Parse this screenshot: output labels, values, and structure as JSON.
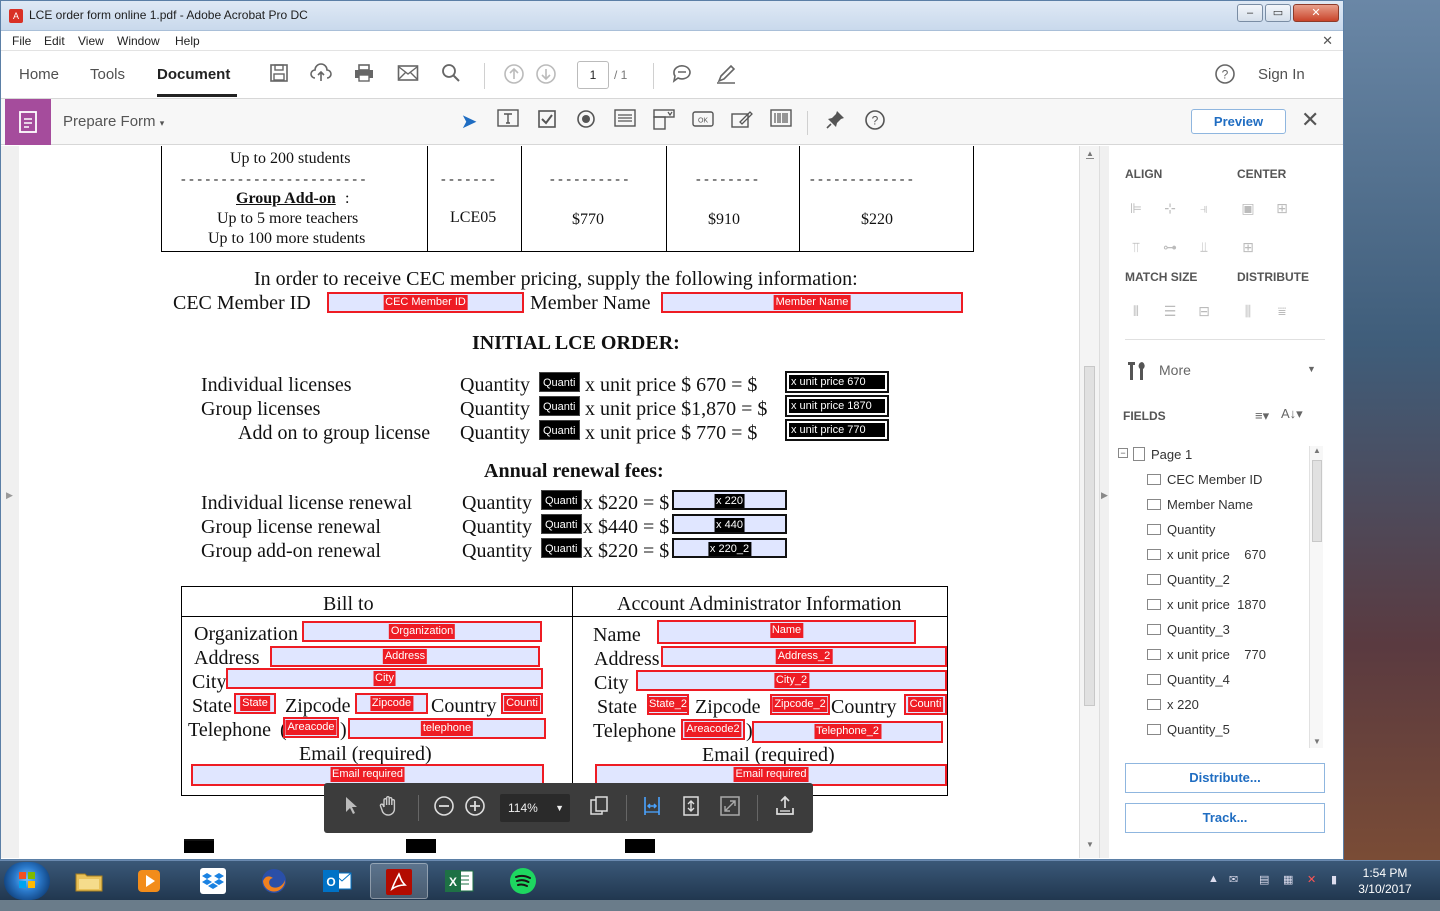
{
  "window": {
    "title": "LCE order form online 1.pdf - Adobe Acrobat Pro DC",
    "icon": "acrobat-icon"
  },
  "menu": [
    "File",
    "Edit",
    "View",
    "Window",
    "Help"
  ],
  "nav": {
    "home": "Home",
    "tools": "Tools",
    "document": "Document",
    "sign_in": "Sign In"
  },
  "page_nav": {
    "current": "1",
    "total": "/ 1"
  },
  "prepare": {
    "title": "Prepare Form",
    "preview": "Preview"
  },
  "doc": {
    "table_top": {
      "row1": "Up to 200 students",
      "dashes_long": "- - - - - - - - - - - - - - - - - - - - - - -",
      "dashes_a": "- - - - - - -",
      "dashes_b": "- - - - - - - - - -",
      "dashes_c": "- - - - - - - -",
      "dashes_d": "- -  - - - - - - - - - - -",
      "addon_title": "Group Add-on",
      "addon_colon": ":",
      "addon_l2": "Up to 5 more teachers",
      "addon_l3": "Up to 100 more students",
      "code": "LCE05",
      "p1": "$770",
      "p2": "$910",
      "p3": "$220"
    },
    "member_intro": "In order to receive CEC member pricing, supply the following information:",
    "member_id_label": "CEC Member ID",
    "member_id_field": "CEC Member ID",
    "member_name_label": "Member Name",
    "member_name_field": "Member Name",
    "initial_title": "INITIAL LCE ORDER:",
    "initial_rows": [
      {
        "label": "Individual licenses",
        "qty": "Quantity",
        "qfield": "Quanti",
        "unit": "x unit price  $    670 = $",
        "result": "x unit price    670"
      },
      {
        "label": "Group licenses",
        "qty": "Quantity",
        "qfield": "Quanti",
        "unit": "x unit price  $1,870 = $",
        "result": "x unit price  1870"
      },
      {
        "label": "Add on to group license",
        "qty": "Quantity",
        "qfield": "Quanti",
        "unit": "x unit price  $    770 = $",
        "result": "x unit price    770"
      }
    ],
    "renewal_title": "Annual renewal fees:",
    "renewal_rows": [
      {
        "label": "Individual license renewal",
        "qty": "Quantity",
        "qfield": "Quanti",
        "unit": "x $220 = $",
        "result": "x 220"
      },
      {
        "label": "Group license renewal",
        "qty": "Quantity",
        "qfield": "Quanti",
        "unit": "x $440 = $",
        "result": "x 440"
      },
      {
        "label": "Group add-on renewal",
        "qty": "Quantity",
        "qfield": "Quanti",
        "unit": "x $220 = $",
        "result": "x 220_2"
      }
    ],
    "bill": {
      "title": "Bill to",
      "org": "Organization",
      "org_f": "Organization",
      "addr": "Address",
      "addr_f": "Address",
      "city": "City",
      "city_f": "City",
      "state": "State",
      "state_f": "State",
      "zip": "Zipcode",
      "zip_f": "Zipcode",
      "country": "Country",
      "country_f": "Counti",
      "tel": "Telephone",
      "paren_open": "(",
      "area_f": "Areacode",
      "paren_close": ")",
      "tel_f": "telephone",
      "email": "Email (required)",
      "email_f": "Email required"
    },
    "admin": {
      "title": "Account Administrator Information",
      "name": "Name",
      "name_f": "Name",
      "addr": "Address",
      "addr_f": "Address_2",
      "city": "City",
      "city_f": "City_2",
      "state": "State",
      "state_f": "State_2",
      "zip": "Zipcode",
      "zip_f": "Zipcode_2",
      "country": "Country",
      "country_f": "Counti",
      "tel": "Telephone",
      "area_f": "Areacode2",
      "paren_close": ")",
      "tel_f": "Telephone_2",
      "email": "Email (required)",
      "email_f": "Email required"
    }
  },
  "float_toolbar": {
    "zoom": "114%"
  },
  "right_panel": {
    "align": "ALIGN",
    "center": "CENTER",
    "match_size": "MATCH SIZE",
    "distribute": "DISTRIBUTE",
    "more": "More",
    "fields": "FIELDS",
    "page": "Page 1",
    "field_list": [
      "CEC Member ID",
      "Member Name",
      "Quantity",
      "x unit price    670",
      "Quantity_2",
      "x unit price  1870",
      "Quantity_3",
      "x unit price    770",
      "Quantity_4",
      "x 220",
      "Quantity_5"
    ],
    "distribute_btn": "Distribute...",
    "track_btn": "Track..."
  },
  "taskbar": {
    "time": "1:54 PM",
    "date": "3/10/2017"
  }
}
